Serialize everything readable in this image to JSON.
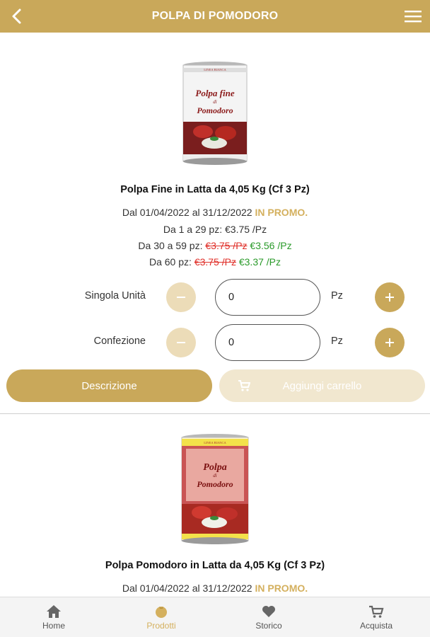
{
  "header": {
    "title": "POLPA DI POMODORO"
  },
  "products": [
    {
      "name": "Polpa Fine in Latta da 4,05 Kg (Cf 3 Pz)",
      "can_label_top": "LINEA BIANCA",
      "can_label_main1": "Polpa fine",
      "can_label_main2": "di",
      "can_label_main3": "Pomodoro",
      "promo_dates": "Dal 01/04/2022 al 31/12/2022",
      "promo_label": "IN PROMO.",
      "tier1": "Da 1 a 29 pz: €3.75 /Pz",
      "tier2_prefix": "Da 30 a 59 pz:",
      "tier2_old": "€3.75 /Pz",
      "tier2_new": "€3.56 /Pz",
      "tier3_prefix": "Da 60 pz:",
      "tier3_old": "€3.75 /Pz",
      "tier3_new": "€3.37 /Pz",
      "unit_label": "Singola Unità",
      "unit_value": "0",
      "pack_label": "Confezione",
      "pack_value": "0",
      "unit_suffix": "Pz",
      "description_button": "Descrizione",
      "add_cart_button": "Aggiungi carrello"
    },
    {
      "name": "Polpa Pomodoro in Latta da 4,05 Kg (Cf 3 Pz)",
      "can_label_top": "LINEA BIANCA",
      "can_label_main1": "Polpa",
      "can_label_main2": "di",
      "can_label_main3": "Pomodoro",
      "promo_dates": "Dal 01/04/2022 al 31/12/2022",
      "promo_label": "IN PROMO."
    }
  ],
  "bottom_nav": [
    {
      "label": "Home",
      "icon": "home-icon"
    },
    {
      "label": "Prodotti",
      "icon": "tomato-icon",
      "active": true
    },
    {
      "label": "Storico",
      "icon": "heart-icon"
    },
    {
      "label": "Acquista",
      "icon": "cart-icon"
    }
  ],
  "colors": {
    "accent": "#c9a85a",
    "promo": "#d4b05e",
    "strike": "#e0302a",
    "discount": "#2a9a2a"
  }
}
